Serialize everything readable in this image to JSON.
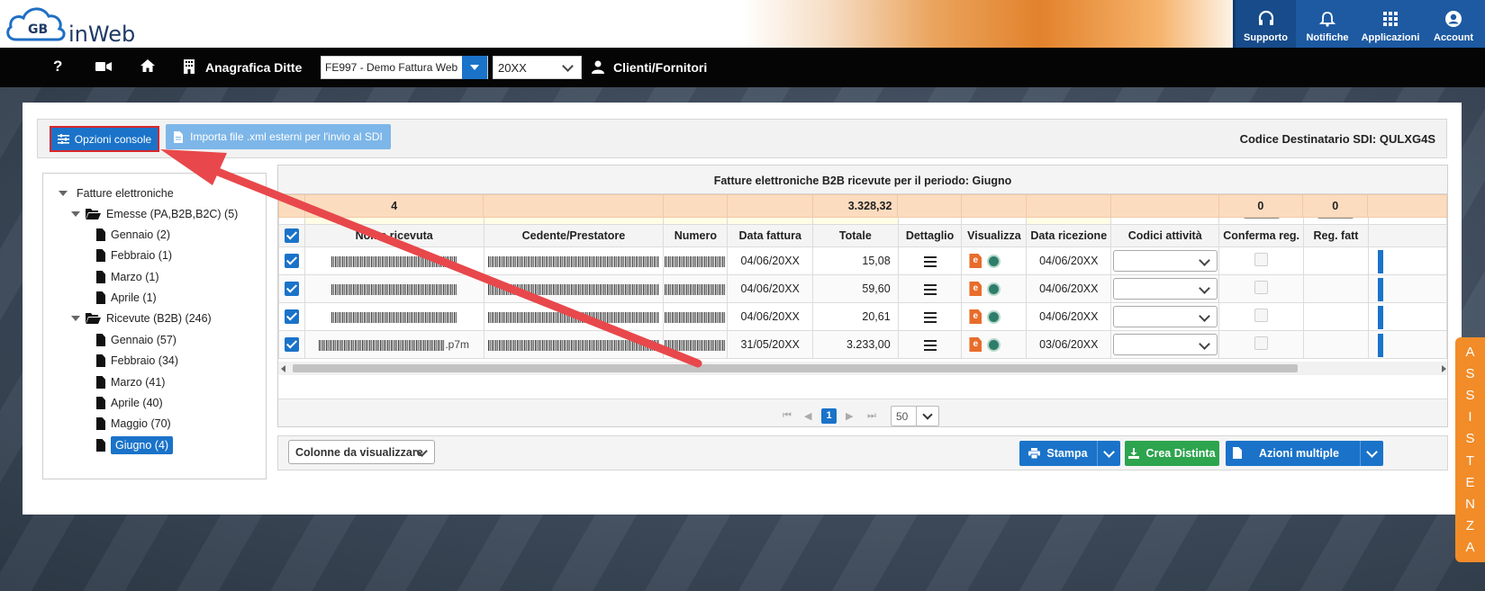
{
  "brand": {
    "logo_text": "inWeb",
    "logo_badge": "GB"
  },
  "topnav": [
    {
      "label": "Supporto",
      "icon": "headset-icon"
    },
    {
      "label": "Notifiche",
      "icon": "bell-icon"
    },
    {
      "label": "Applicazioni",
      "icon": "apps-grid-icon"
    },
    {
      "label": "Account",
      "icon": "user-circle-icon"
    }
  ],
  "navbar": {
    "help": "?",
    "anagrafica_label": "Anagrafica Ditte",
    "company_value": "FE997 - Demo Fattura Web",
    "year_value": "20XX",
    "clienti_label": "Clienti/Fornitori"
  },
  "toolbar": {
    "opzioni_label": "Opzioni console",
    "importa_label": "Importa file .xml esterni per l'invio al SDI",
    "codice_label": "Codice Destinatario SDI: QULXG4S"
  },
  "tree": {
    "root": "Fatture elettroniche",
    "emesse": {
      "label": "Emesse (PA,B2B,B2C) (5)",
      "items": [
        "Gennaio (2)",
        "Febbraio (1)",
        "Marzo (1)",
        "Aprile (1)"
      ]
    },
    "ricevute": {
      "label": "Ricevute (B2B) (246)",
      "items": [
        "Gennaio (57)",
        "Febbraio (34)",
        "Marzo (41)",
        "Aprile (40)",
        "Maggio (70)",
        "Giugno (4)"
      ]
    }
  },
  "grid": {
    "title": "Fatture elettroniche B2B ricevute per il periodo: Giugno",
    "columns": [
      "Nome ricevuta",
      "Cedente/Prestatore",
      "Numero",
      "Data fattura",
      "Totale",
      "Dettaglio",
      "Visualizza",
      "Data ricezione",
      "Codici attività",
      "Conferma reg.",
      "Reg. fatt"
    ],
    "rows": [
      {
        "nome_suffix": "",
        "data_fattura": "04/06/20XX",
        "totale": "15,08",
        "data_ricezione": "04/06/20XX"
      },
      {
        "nome_suffix": "",
        "data_fattura": "04/06/20XX",
        "totale": "59,60",
        "data_ricezione": "04/06/20XX"
      },
      {
        "nome_suffix": "",
        "data_fattura": "04/06/20XX",
        "totale": "20,61",
        "data_ricezione": "04/06/20XX"
      },
      {
        "nome_suffix": ".p7m",
        "data_fattura": "31/05/20XX",
        "totale": "3.233,00",
        "data_ricezione": "03/06/20XX"
      }
    ],
    "totals": {
      "count": "4",
      "totale": "3.328,32",
      "conferma": "0",
      "reg": "0"
    },
    "pager": {
      "current": "1",
      "page_size": "50"
    }
  },
  "bottombar": {
    "colonne_label": "Colonne da visualizzare",
    "stampa_label": "Stampa",
    "distinta_label": "Crea Distinta",
    "azioni_label": "Azioni multiple"
  },
  "assistenza": [
    "A",
    "S",
    "S",
    "I",
    "S",
    "T",
    "E",
    "N",
    "Z",
    "A"
  ],
  "colors": {
    "primary": "#1a73c9",
    "accent_orange": "#f28c28",
    "success": "#2da44e",
    "totals_bg": "#fcdcbf",
    "arrow": "#e8484b"
  }
}
